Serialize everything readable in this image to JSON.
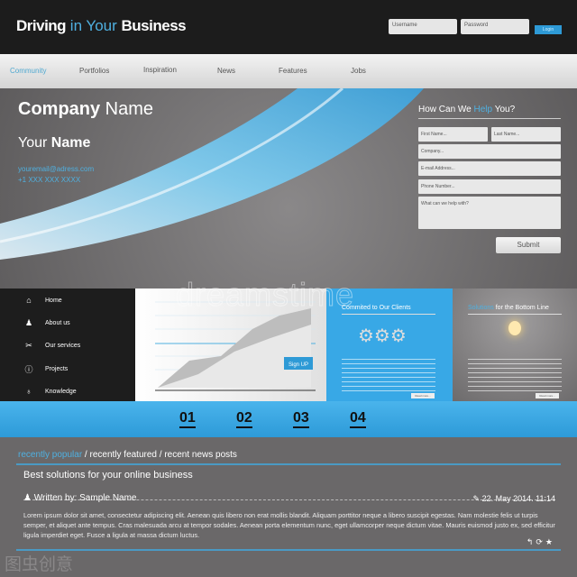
{
  "header": {
    "logo_bold1": "Driving",
    "logo_mid": " in Your ",
    "logo_bold2": "Business",
    "username_placeholder": "Username",
    "password_placeholder": "Password",
    "login_label": "Login"
  },
  "nav": [
    "Community",
    "Portfolios",
    "Inspiration",
    "News",
    "Features",
    "Jobs"
  ],
  "hero": {
    "company_bold": "Company",
    "company_rest": " Name",
    "your": "Your ",
    "name_bold": "Name",
    "email": "youremail@adress.com",
    "phone": "+1 XXX XXX XXXX"
  },
  "form": {
    "title_a": "How Can We ",
    "title_help": "Help",
    "title_b": " You?",
    "first_name": "First Name...",
    "last_name": "Last Name...",
    "company": "Company...",
    "email": "E-mail Address...",
    "phone": "Phone Number...",
    "message": "What can we help with?",
    "submit": "Submit"
  },
  "sidebar": [
    {
      "label": "Home",
      "icon": "home-icon"
    },
    {
      "label": "About us",
      "icon": "people-icon"
    },
    {
      "label": "Our services",
      "icon": "tools-icon"
    },
    {
      "label": "Projects",
      "icon": "info-icon"
    },
    {
      "label": "Knowledge",
      "icon": "bulb-icon"
    }
  ],
  "chart_panel": {
    "signup": "Sign UP"
  },
  "panels": [
    {
      "title": "Commited to Our Clients",
      "read_more": "Read more..."
    },
    {
      "title_accent": "Solutions",
      "title": " for the Bottom Line",
      "read_more": "Read more..."
    }
  ],
  "steps": [
    "01",
    "02",
    "03",
    "04"
  ],
  "watermark": "dreamstime",
  "news": {
    "tab_active": "recently popular",
    "tab_rest": " / recently featured / recent news posts",
    "title": "Best solutions for your online business",
    "author": "Written by: Sample Name",
    "date": "22. May 2014.  11:14",
    "body": "Lorem ipsum dolor sit amet, consectetur adipiscing elit. Aenean quis libero non erat mollis blandit. Aliquam porttitor neque a libero suscipit egestas. Nam molestie felis ut turpis semper, et aliquet ante tempus. Cras malesuada arcu at tempor sodales. Aenean porta elementum nunc, eget ullamcorper neque dictum vitae. Mauris euismod justo ex, sed efficitur ligula imperdiet eget. Fusce a ligula at massa dictum luctus.",
    "actions": "↰⟳★"
  },
  "corner_watermark": "图虫创意",
  "colors": {
    "accent": "#4fb0e0",
    "header_bg": "#1c1c1c",
    "band": "#38a8e6"
  }
}
